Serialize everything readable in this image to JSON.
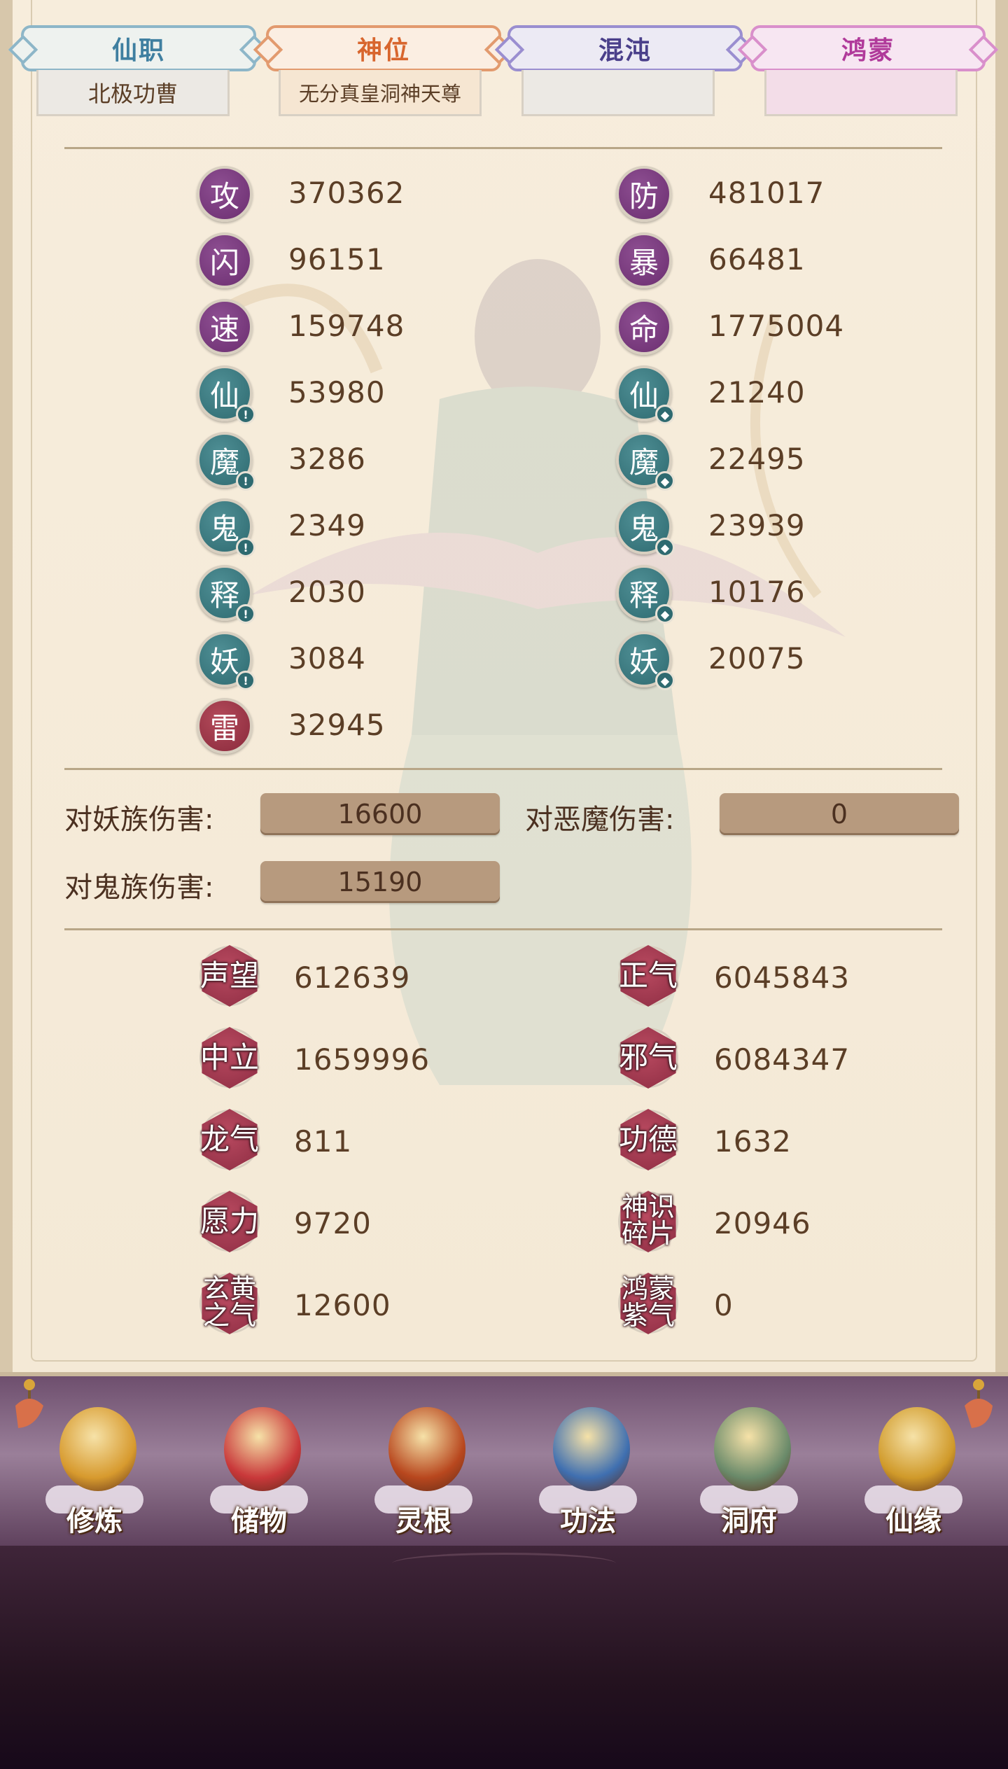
{
  "tabs": [
    {
      "label": "仙职",
      "sub": "北极功曹",
      "color": "#3f7fa0",
      "bg": "#eef2ef",
      "border": "#8db6c8"
    },
    {
      "label": "神位",
      "sub": "无分真皇洞神天尊",
      "color": "#d8662e",
      "bg": "#fbeee2",
      "border": "#e29a6e"
    },
    {
      "label": "混沌",
      "sub": "",
      "color": "#4a3f8a",
      "bg": "#eceaf4",
      "border": "#9a8ed0"
    },
    {
      "label": "鸿蒙",
      "sub": "",
      "color": "#b03a9a",
      "bg": "#f7e6f2",
      "border": "#d98fcb"
    }
  ],
  "stats_left": [
    {
      "icon": "攻",
      "value": "370362",
      "style": "purple",
      "badge": ""
    },
    {
      "icon": "闪",
      "value": "96151",
      "style": "purple",
      "badge": ""
    },
    {
      "icon": "速",
      "value": "159748",
      "style": "purple",
      "badge": ""
    },
    {
      "icon": "仙",
      "value": "53980",
      "style": "teal",
      "badge": "attack"
    },
    {
      "icon": "魔",
      "value": "3286",
      "style": "teal",
      "badge": "attack"
    },
    {
      "icon": "鬼",
      "value": "2349",
      "style": "teal",
      "badge": "attack"
    },
    {
      "icon": "释",
      "value": "2030",
      "style": "teal",
      "badge": "attack"
    },
    {
      "icon": "妖",
      "value": "3084",
      "style": "teal",
      "badge": "attack"
    },
    {
      "icon": "雷",
      "value": "32945",
      "style": "red",
      "badge": ""
    }
  ],
  "stats_right": [
    {
      "icon": "防",
      "value": "481017",
      "style": "purple",
      "badge": ""
    },
    {
      "icon": "暴",
      "value": "66481",
      "style": "purple",
      "badge": ""
    },
    {
      "icon": "命",
      "value": "1775004",
      "style": "purple",
      "badge": ""
    },
    {
      "icon": "仙",
      "value": "21240",
      "style": "teal",
      "badge": "defense"
    },
    {
      "icon": "魔",
      "value": "22495",
      "style": "teal",
      "badge": "defense"
    },
    {
      "icon": "鬼",
      "value": "23939",
      "style": "teal",
      "badge": "defense"
    },
    {
      "icon": "释",
      "value": "10176",
      "style": "teal",
      "badge": "defense"
    },
    {
      "icon": "妖",
      "value": "20075",
      "style": "teal",
      "badge": "defense"
    }
  ],
  "damage": {
    "yao_label": "对妖族伤害:",
    "yao_value": "16600",
    "demon_label": "对恶魔伤害:",
    "demon_value": "0",
    "ghost_label": "对鬼族伤害:",
    "ghost_value": "15190"
  },
  "currencies_left": [
    {
      "label": "声望",
      "value": "612639"
    },
    {
      "label": "中立",
      "value": "1659996"
    },
    {
      "label": "龙气",
      "value": "811"
    },
    {
      "label": "愿力",
      "value": "9720"
    },
    {
      "label": "玄黄之气",
      "value": "12600"
    }
  ],
  "currencies_right": [
    {
      "label": "正气",
      "value": "6045843"
    },
    {
      "label": "邪气",
      "value": "6084347"
    },
    {
      "label": "功德",
      "value": "1632"
    },
    {
      "label": "神识碎片",
      "value": "20946"
    },
    {
      "label": "鸿蒙紫气",
      "value": "0"
    }
  ],
  "nav": [
    {
      "label": "修炼",
      "icon": "monk-icon",
      "color": "#d79a2e"
    },
    {
      "label": "储物",
      "icon": "bag-icon",
      "color": "#c9383a"
    },
    {
      "label": "灵根",
      "icon": "spirit-root-icon",
      "color": "#b8471e"
    },
    {
      "label": "功法",
      "icon": "book-icon",
      "color": "#3f6fb0"
    },
    {
      "label": "洞府",
      "icon": "palace-icon",
      "color": "#6a8a6a"
    },
    {
      "label": "仙缘",
      "icon": "gourd-icon",
      "color": "#d09a2a"
    }
  ]
}
